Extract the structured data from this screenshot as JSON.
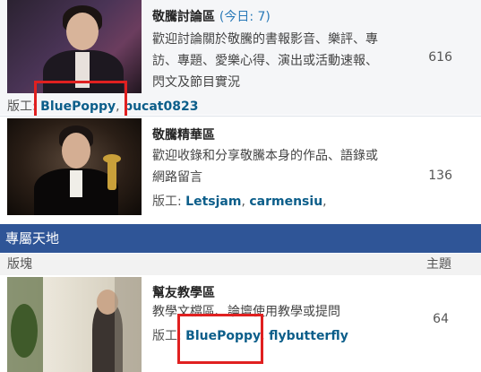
{
  "forums": [
    {
      "title": "敬騰討論區",
      "today": "(今日: 7)",
      "desc": "歡迎討論關於敬騰的書報影音、樂評、專訪、專題、愛樂心得、演出或活動速報、閃文及節目實況",
      "count": "616",
      "mods_label": "版工:",
      "mods": [
        "BluePoppy",
        "pucat0823"
      ]
    },
    {
      "title": "敬騰精華區",
      "desc": "歡迎收錄和分享敬騰本身的作品、語錄或網路留言",
      "count": "136",
      "mods_label": "版工:",
      "mods": [
        "Letsjam",
        "carmensiu"
      ]
    }
  ],
  "section": {
    "title": "專屬天地",
    "col_board": "版塊",
    "col_topics": "主題"
  },
  "forum3": {
    "title": "幫友教學區",
    "desc": "教學文檔區、論壇使用教學或提問",
    "count": "64",
    "mods_label": "版工:",
    "mods": [
      "BluePoppy",
      "flybutterfly"
    ]
  },
  "colors": {
    "section_bar": "#2f5597",
    "link": "#0c5e8a",
    "highlight_box": "#e02020",
    "today": "#2a7ab8"
  }
}
